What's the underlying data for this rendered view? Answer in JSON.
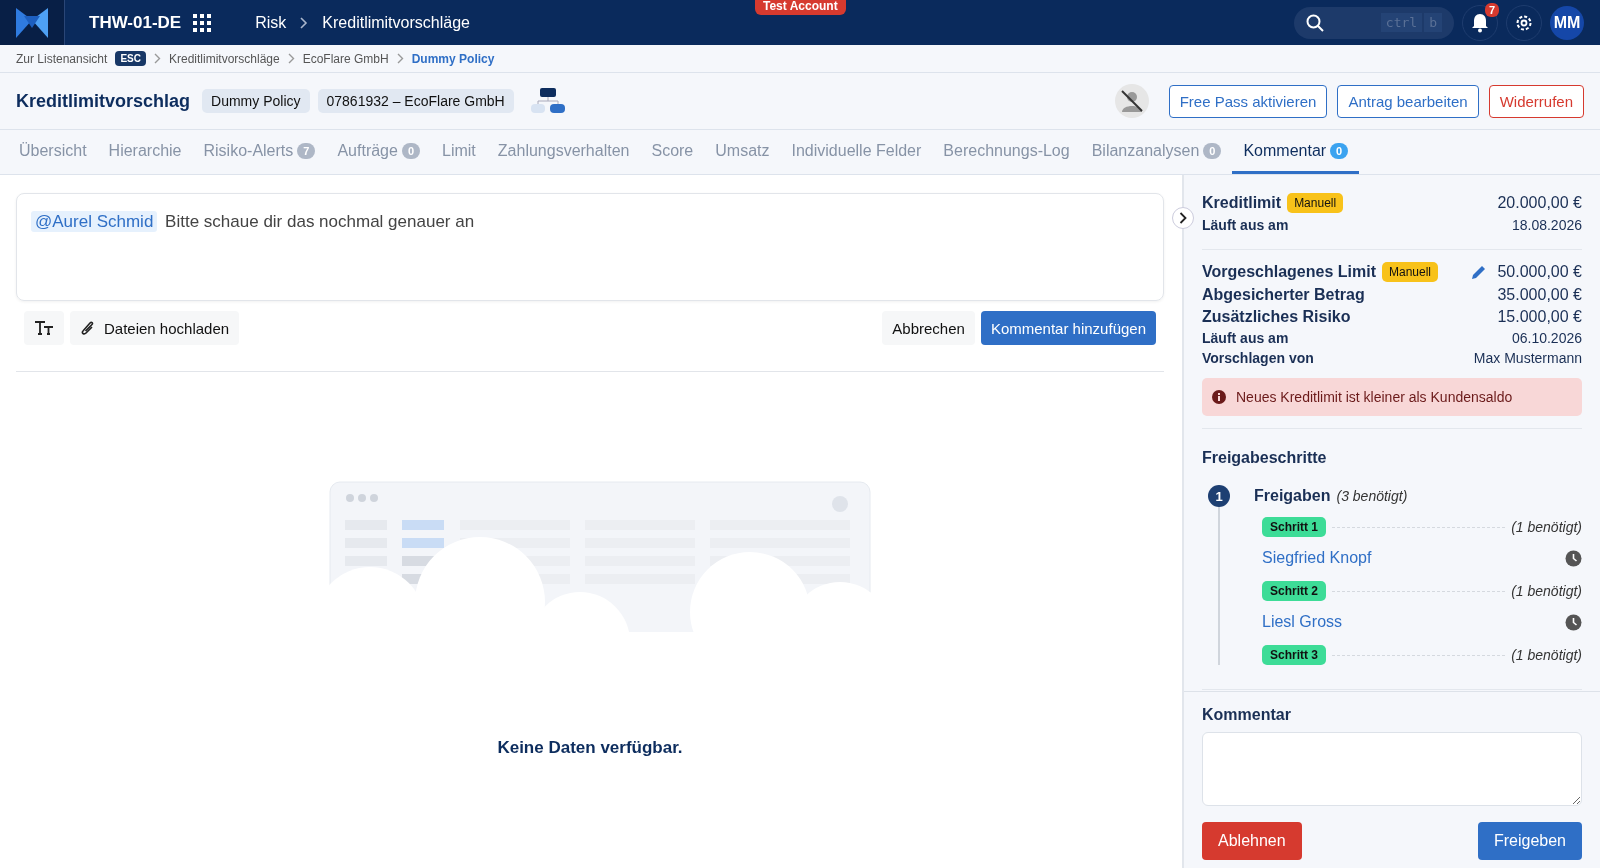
{
  "topbar": {
    "environment": "THW-01-DE",
    "breadcrumb": [
      "Risk",
      "Kreditlimitvorschläge"
    ],
    "badge": "Test Account",
    "search_keys": [
      "ctrl",
      "b"
    ],
    "notifications": "7",
    "avatar": "MM"
  },
  "breadcrumbs": {
    "back": "Zur Listenansicht",
    "key": "ESC",
    "items": [
      {
        "label": "Kreditlimitvorschläge",
        "selected": false
      },
      {
        "label": "EcoFlare GmbH",
        "selected": false
      },
      {
        "label": "Dummy Policy",
        "selected": true
      }
    ]
  },
  "header": {
    "title": "Kreditlimitvorschlag",
    "tags": [
      "Dummy Policy",
      "07861932 – EcoFlare GmbH"
    ],
    "actions": [
      {
        "label": "Free Pass aktivieren",
        "kind": "primary"
      },
      {
        "label": "Antrag bearbeiten",
        "kind": "primary"
      },
      {
        "label": "Widerrufen",
        "kind": "danger"
      }
    ]
  },
  "tabs": [
    {
      "label": "Übersicht",
      "selected": false
    },
    {
      "label": "Hierarchie",
      "selected": false
    },
    {
      "label": "Risiko-Alerts",
      "count": "7",
      "selected": false
    },
    {
      "label": "Aufträge",
      "count": "0",
      "selected": false
    },
    {
      "label": "Limit",
      "selected": false
    },
    {
      "label": "Zahlungsverhalten",
      "selected": false
    },
    {
      "label": "Score",
      "selected": false
    },
    {
      "label": "Umsatz",
      "selected": false
    },
    {
      "label": "Individuelle Felder",
      "selected": false
    },
    {
      "label": "Berechnungs-Log",
      "selected": false
    },
    {
      "label": "Bilanzanalysen",
      "count": "0",
      "selected": false
    },
    {
      "label": "Kommentar",
      "count": "0",
      "selected": true
    }
  ],
  "comment_editor": {
    "mention": "@Aurel Schmid",
    "text": "Bitte schaue dir das nochmal genauer an",
    "upload": "Dateien hochladen",
    "cancel": "Abbrechen",
    "submit": "Kommentar hinzufügen"
  },
  "empty_state": "Keine Daten verfügbar.",
  "side_panel": {
    "current": [
      {
        "label": "Kreditlimit",
        "badge": "Manuell",
        "value": "20.000,00 €",
        "kind": "large"
      },
      {
        "label": "Läuft aus am",
        "value": "18.08.2026",
        "kind": "small"
      }
    ],
    "proposal": [
      {
        "label": "Vorgeschlagenes Limit",
        "badge": "Manuell",
        "value": "50.000,00 €",
        "kind": "large",
        "editable": true
      },
      {
        "label": "Abgesicherter Betrag",
        "value": "35.000,00 €",
        "kind": "large"
      },
      {
        "label": "Zusätzliches Risiko",
        "value": "15.000,00 €",
        "kind": "large"
      },
      {
        "label": "Läuft aus am",
        "value": "06.10.2026",
        "kind": "small"
      },
      {
        "label": "Vorschlagen von",
        "value": "Max Mustermann",
        "kind": "small"
      }
    ],
    "alert": "Neues Kreditlimit ist kleiner als Kundensaldo",
    "steps_title": "Freigabeschritte",
    "group": {
      "number": "1",
      "title": "Freigaben",
      "note": "(3 benötigt)",
      "steps": [
        {
          "label": "Schritt 1",
          "note": "(1 benötigt)",
          "approvers": [
            "Siegfried Knopf"
          ]
        },
        {
          "label": "Schritt 2",
          "note": "(1 benötigt)",
          "approvers": [
            "Liesl Gross"
          ]
        },
        {
          "label": "Schritt 3",
          "note": "(1 benötigt)"
        }
      ]
    },
    "comment_label": "Kommentar",
    "reject": "Ablehnen",
    "approve": "Freigeben"
  }
}
